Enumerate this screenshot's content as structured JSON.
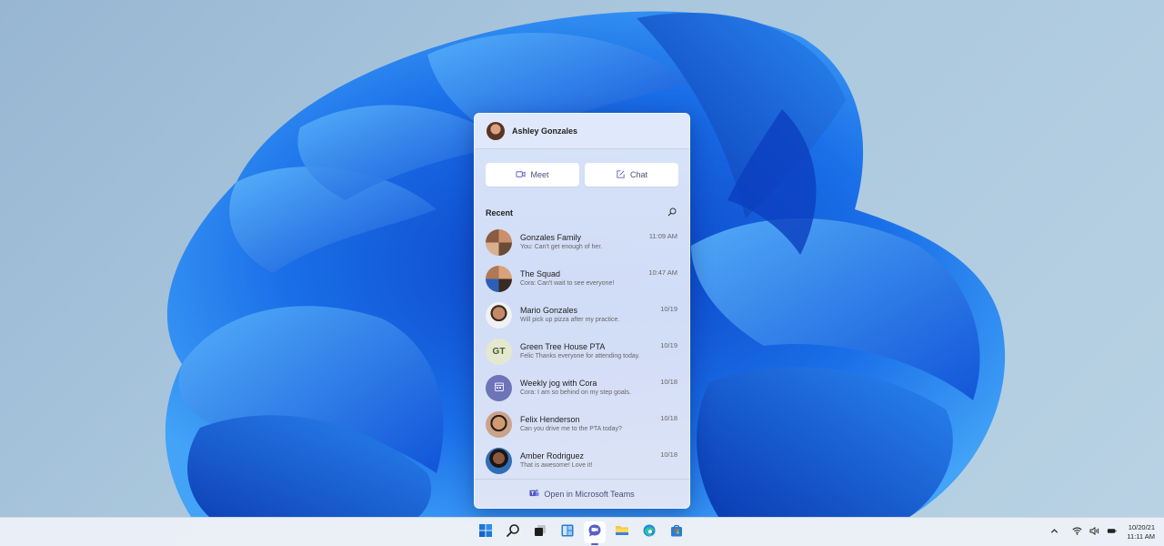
{
  "desktop": {
    "wallpaper": "Windows 11 Bloom",
    "colors": {
      "sky": "#a9c4da",
      "bloom": "#1a6fe8",
      "bloom_light": "#3a9cf5"
    }
  },
  "chat_flyout": {
    "user": {
      "name": "Ashley Gonzales",
      "avatar": "photo"
    },
    "buttons": [
      {
        "label": "Meet",
        "icon": "video-camera-icon"
      },
      {
        "label": "Chat",
        "icon": "compose-icon"
      }
    ],
    "recent_label": "Recent",
    "search_icon": "search-icon",
    "conversations": [
      {
        "name": "Gonzales Family",
        "preview": "You: Can't get enough of her.",
        "time": "11:09 AM",
        "avatar": "group-photo"
      },
      {
        "name": "The Squad",
        "preview": "Cora: Can't wait to see everyone!",
        "time": "10:47 AM",
        "avatar": "group-photo"
      },
      {
        "name": "Mario Gonzales",
        "preview": "Will pick up pizza after my practice.",
        "time": "10/19",
        "avatar": "photo"
      },
      {
        "name": "Green Tree House PTA",
        "preview": "Felic Thanks everyone for attending today.",
        "time": "10/19",
        "avatar": "initials",
        "initials": "GT"
      },
      {
        "name": "Weekly jog with Cora",
        "preview": "Cora: I am so behind on my step goals.",
        "time": "10/18",
        "avatar": "calendar-icon"
      },
      {
        "name": "Felix Henderson",
        "preview": "Can you drive me to the PTA today?",
        "time": "10/18",
        "avatar": "photo"
      },
      {
        "name": "Amber Rodriguez",
        "preview": "That is awesome! Love it!",
        "time": "10/18",
        "avatar": "photo"
      }
    ],
    "footer": {
      "label": "Open in Microsoft Teams",
      "icon": "teams-icon"
    },
    "accent": "#5b5fc7"
  },
  "taskbar": {
    "apps": [
      {
        "name": "Start",
        "icon": "windows-logo-icon"
      },
      {
        "name": "Search",
        "icon": "search-icon"
      },
      {
        "name": "Task View",
        "icon": "task-view-icon"
      },
      {
        "name": "Widgets",
        "icon": "widgets-icon"
      },
      {
        "name": "Chat",
        "icon": "teams-chat-icon",
        "active": true
      },
      {
        "name": "File Explorer",
        "icon": "folder-icon"
      },
      {
        "name": "Microsoft Edge",
        "icon": "edge-icon"
      },
      {
        "name": "Microsoft Store",
        "icon": "store-icon"
      }
    ],
    "tray": {
      "icons": [
        "chevron-up-icon",
        "wifi-icon",
        "volume-icon",
        "battery-icon"
      ],
      "date": "10/20/21",
      "time": "11:11 AM"
    }
  }
}
